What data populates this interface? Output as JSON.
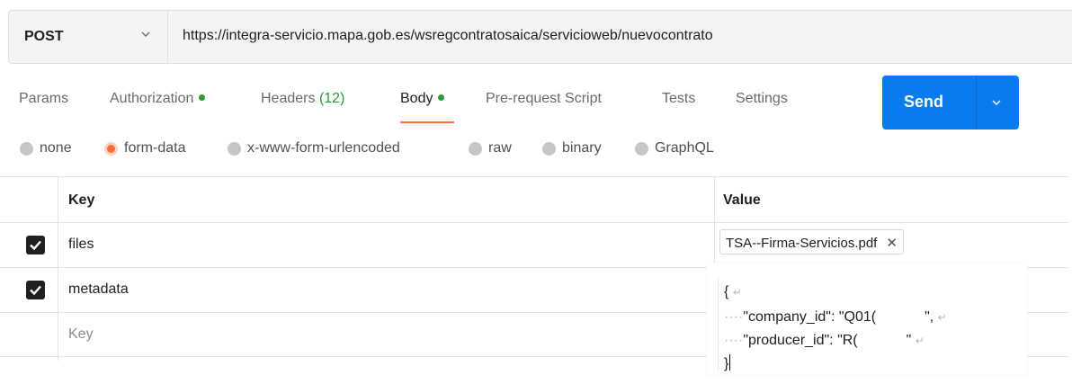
{
  "request": {
    "method": "POST",
    "url": "https://integra-servicio.mapa.gob.es/wsregcontratosaica/servicioweb/nuevocontrato"
  },
  "tabs": [
    {
      "label": "Params"
    },
    {
      "label": "Authorization"
    },
    {
      "label": "Headers",
      "count": "(12)"
    },
    {
      "label": "Body"
    },
    {
      "label": "Pre-request Script"
    },
    {
      "label": "Tests"
    },
    {
      "label": "Settings"
    }
  ],
  "send": {
    "label": "Send"
  },
  "body_types": [
    {
      "label": "none",
      "selected": false
    },
    {
      "label": "form-data",
      "selected": true
    },
    {
      "label": "x-www-form-urlencoded",
      "selected": false
    },
    {
      "label": "raw",
      "selected": false
    },
    {
      "label": "binary",
      "selected": false
    },
    {
      "label": "GraphQL",
      "selected": false
    }
  ],
  "table": {
    "header": {
      "key": "Key",
      "value": "Value"
    },
    "rows": [
      {
        "key": "files",
        "checked": true,
        "value": "TSA--Firma-Servicios.pdf"
      },
      {
        "key": "metadata",
        "checked": true
      }
    ],
    "new_row_placeholder": "Key"
  },
  "json_editor": {
    "line1": "{",
    "line2_key": "\"company_id\": \"Q01(",
    "line2_end": "\",",
    "line3_key": "\"producer_id\": \"R(",
    "line3_end": "\"",
    "line4": "}"
  },
  "colors": {
    "accent": "#ff6c37",
    "send": "#097bed",
    "status_dot": "#2a9a3a"
  }
}
